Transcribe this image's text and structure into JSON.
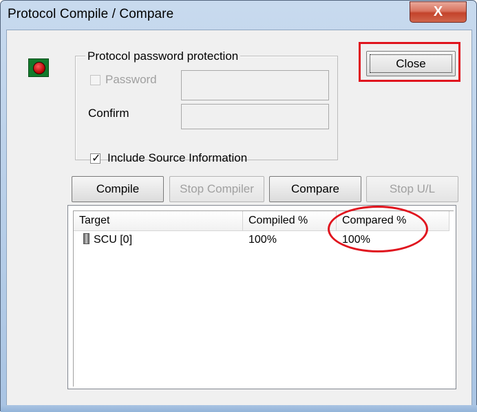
{
  "window": {
    "title": "Protocol Compile / Compare",
    "close_glyph": "X"
  },
  "status_icon": "record-icon",
  "protection": {
    "group_label": "Protocol password protection",
    "password_label": "Password",
    "password_checked": false,
    "password_value": "",
    "confirm_label": "Confirm",
    "confirm_value": ""
  },
  "close_button_label": "Close",
  "include_source": {
    "label": "Include Source Information",
    "checked": true
  },
  "buttons": {
    "compile": "Compile",
    "stop_compiler": "Stop Compiler",
    "compare": "Compare",
    "stop_ul": "Stop U/L"
  },
  "list": {
    "columns": [
      "Target",
      "Compiled %",
      "Compared %"
    ],
    "rows": [
      {
        "icon": "device-icon",
        "target": "SCU [0]",
        "compiled": "100%",
        "compared": "100%"
      }
    ]
  },
  "annotation_color": "#e0141e"
}
